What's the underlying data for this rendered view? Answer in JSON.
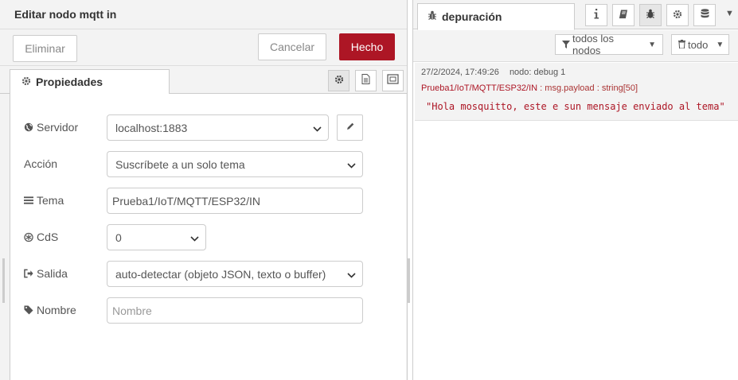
{
  "editor": {
    "title": "Editar nodo mqtt in",
    "buttons": {
      "delete": "Eliminar",
      "cancel": "Cancelar",
      "done": "Hecho"
    },
    "tab_label": "Propiedades",
    "fields": {
      "server": {
        "label": "Servidor",
        "value": "localhost:1883"
      },
      "action": {
        "label": "Acción",
        "value": "Suscríbete a un solo tema"
      },
      "topic": {
        "label": "Tema",
        "value": "Prueba1/IoT/MQTT/ESP32/IN"
      },
      "qos": {
        "label": "CdS",
        "value": "0"
      },
      "output": {
        "label": "Salida",
        "value": "auto-detectar (objeto JSON, texto o buffer)"
      },
      "name": {
        "label": "Nombre",
        "value": "",
        "placeholder": "Nombre"
      }
    }
  },
  "sidebar": {
    "tab_label": "depuración",
    "filter_nodes": "todos los nodos",
    "filter_all": "todo",
    "messages": [
      {
        "timestamp": "27/2/2024, 17:49:26",
        "node": "nodo: debug 1",
        "topic": "Prueba1/IoT/MQTT/ESP32/IN",
        "property": " : msg.payload : string[50]",
        "payload": "\"Hola mosquitto, este e sun mensaje enviado al tema\""
      }
    ]
  },
  "colors": {
    "accent": "#ad1625",
    "panel_bg": "#f3f3f3",
    "border": "#cccccc"
  },
  "icons": [
    "gear-icon",
    "document-icon",
    "frame-icon",
    "globe-icon",
    "pencil-icon",
    "list-icon",
    "qos-icon",
    "sign-out-icon",
    "tag-icon",
    "bug-icon",
    "info-icon",
    "book-icon",
    "database-icon",
    "filter-icon",
    "trash-icon",
    "chevron-down-icon"
  ]
}
